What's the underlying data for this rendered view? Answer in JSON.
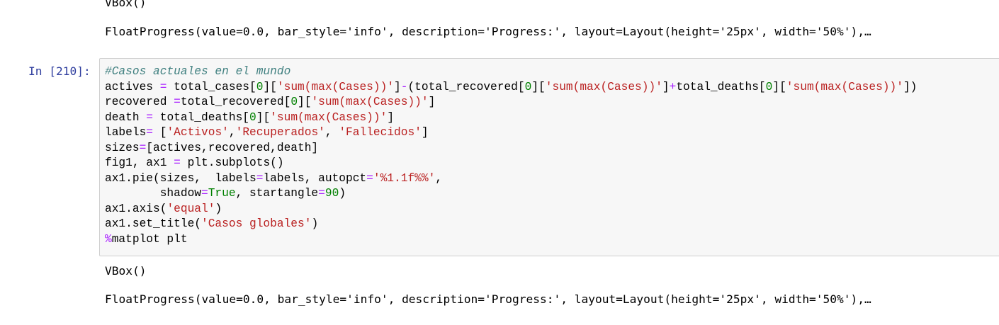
{
  "outputs_top": {
    "vbox": "VBox()",
    "progress": "FloatProgress(value=0.0, bar_style='info', description='Progress:', layout=Layout(height='25px', width='50%'),…"
  },
  "cell": {
    "prompt": "In [210]:",
    "code_lines": [
      [
        {
          "t": "#Casos actuales en el mundo",
          "c": "cm"
        }
      ],
      [
        {
          "t": "actives ",
          "c": ""
        },
        {
          "t": "=",
          "c": "op"
        },
        {
          "t": " total_cases[",
          "c": ""
        },
        {
          "t": "0",
          "c": "nu"
        },
        {
          "t": "][",
          "c": ""
        },
        {
          "t": "'sum(max(Cases))'",
          "c": "st"
        },
        {
          "t": "]",
          "c": ""
        },
        {
          "t": "-",
          "c": "op"
        },
        {
          "t": "(total_recovered[",
          "c": ""
        },
        {
          "t": "0",
          "c": "nu"
        },
        {
          "t": "][",
          "c": ""
        },
        {
          "t": "'sum(max(Cases))'",
          "c": "st"
        },
        {
          "t": "]",
          "c": ""
        },
        {
          "t": "+",
          "c": "op"
        },
        {
          "t": "total_deaths[",
          "c": ""
        },
        {
          "t": "0",
          "c": "nu"
        },
        {
          "t": "][",
          "c": ""
        },
        {
          "t": "'sum(max(Cases))'",
          "c": "st"
        },
        {
          "t": "])",
          "c": ""
        }
      ],
      [
        {
          "t": "recovered ",
          "c": ""
        },
        {
          "t": "=",
          "c": "op"
        },
        {
          "t": "total_recovered[",
          "c": ""
        },
        {
          "t": "0",
          "c": "nu"
        },
        {
          "t": "][",
          "c": ""
        },
        {
          "t": "'sum(max(Cases))'",
          "c": "st"
        },
        {
          "t": "]",
          "c": ""
        }
      ],
      [
        {
          "t": "death ",
          "c": ""
        },
        {
          "t": "=",
          "c": "op"
        },
        {
          "t": " total_deaths[",
          "c": ""
        },
        {
          "t": "0",
          "c": "nu"
        },
        {
          "t": "][",
          "c": ""
        },
        {
          "t": "'sum(max(Cases))'",
          "c": "st"
        },
        {
          "t": "]",
          "c": ""
        }
      ],
      [
        {
          "t": "labels",
          "c": ""
        },
        {
          "t": "=",
          "c": "op"
        },
        {
          "t": " [",
          "c": ""
        },
        {
          "t": "'Activos'",
          "c": "st"
        },
        {
          "t": ",",
          "c": ""
        },
        {
          "t": "'Recuperados'",
          "c": "st"
        },
        {
          "t": ", ",
          "c": ""
        },
        {
          "t": "'Fallecidos'",
          "c": "st"
        },
        {
          "t": "]",
          "c": ""
        }
      ],
      [
        {
          "t": "sizes",
          "c": ""
        },
        {
          "t": "=",
          "c": "op"
        },
        {
          "t": "[actives,recovered,death]",
          "c": ""
        }
      ],
      [
        {
          "t": "fig1, ax1 ",
          "c": ""
        },
        {
          "t": "=",
          "c": "op"
        },
        {
          "t": " plt.subplots()",
          "c": ""
        }
      ],
      [
        {
          "t": "ax1.pie(sizes,  labels",
          "c": ""
        },
        {
          "t": "=",
          "c": "op"
        },
        {
          "t": "labels, autopct",
          "c": ""
        },
        {
          "t": "=",
          "c": "op"
        },
        {
          "t": "'%1.1f%%'",
          "c": "st"
        },
        {
          "t": ",",
          "c": ""
        }
      ],
      [
        {
          "t": "        shadow",
          "c": ""
        },
        {
          "t": "=",
          "c": "op"
        },
        {
          "t": "True",
          "c": "kw"
        },
        {
          "t": ", startangle",
          "c": ""
        },
        {
          "t": "=",
          "c": "op"
        },
        {
          "t": "90",
          "c": "nu"
        },
        {
          "t": ")",
          "c": ""
        }
      ],
      [
        {
          "t": "ax1.axis(",
          "c": ""
        },
        {
          "t": "'equal'",
          "c": "st"
        },
        {
          "t": ")",
          "c": ""
        }
      ],
      [
        {
          "t": "ax1.set_title(",
          "c": ""
        },
        {
          "t": "'Casos globales'",
          "c": "st"
        },
        {
          "t": ")",
          "c": ""
        }
      ],
      [
        {
          "t": "%",
          "c": "mg"
        },
        {
          "t": "matplot plt",
          "c": ""
        }
      ]
    ]
  },
  "outputs_bottom": {
    "vbox": "VBox()",
    "progress": "FloatProgress(value=0.0, bar_style='info', description='Progress:', layout=Layout(height='25px', width='50%'),…"
  }
}
